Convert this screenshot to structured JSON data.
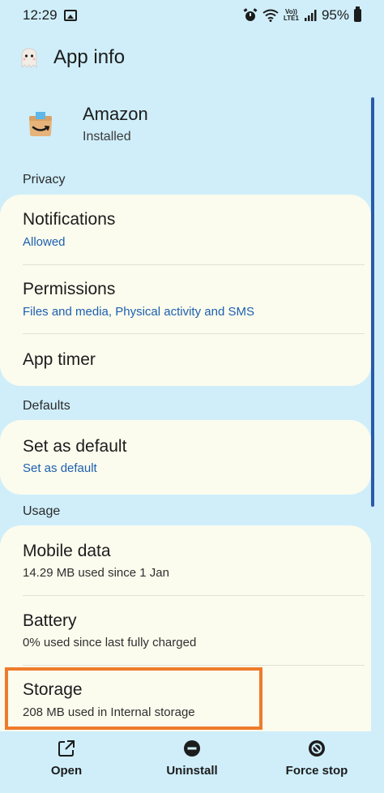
{
  "status_bar": {
    "time": "12:29",
    "volte_top": "Vo))",
    "volte_bottom": "LTE1",
    "battery_percent": "95%",
    "icons": [
      "gallery-icon",
      "alarm-icon",
      "wifi-icon",
      "volte-icon",
      "signal-icon",
      "battery-icon"
    ]
  },
  "header": {
    "title": "App info",
    "icon": "ghost-icon"
  },
  "app": {
    "name": "Amazon",
    "status": "Installed",
    "icon": "amazon-app-icon"
  },
  "sections": {
    "privacy": "Privacy",
    "defaults": "Defaults",
    "usage": "Usage"
  },
  "privacy_items": [
    {
      "title": "Notifications",
      "subtitle": "Allowed"
    },
    {
      "title": "Permissions",
      "subtitle": "Files and media, Physical activity and SMS"
    },
    {
      "title": "App timer",
      "subtitle": ""
    }
  ],
  "defaults_items": [
    {
      "title": "Set as default",
      "subtitle": "Set as default"
    }
  ],
  "usage_items": [
    {
      "title": "Mobile data",
      "subtitle": "14.29 MB used since 1 Jan"
    },
    {
      "title": "Battery",
      "subtitle": "0% used since last fully charged"
    },
    {
      "title": "Storage",
      "subtitle": "208 MB used in Internal storage"
    }
  ],
  "bottom_actions": [
    {
      "label": "Open",
      "icon": "open-external-icon"
    },
    {
      "label": "Uninstall",
      "icon": "uninstall-icon"
    },
    {
      "label": "Force stop",
      "icon": "force-stop-icon"
    }
  ],
  "colors": {
    "background": "#cfeefa",
    "card": "#fbfcee",
    "link_blue": "#1d5fb0",
    "highlight_orange": "#ef7b2a",
    "scrollbar": "#2c5aa6"
  }
}
